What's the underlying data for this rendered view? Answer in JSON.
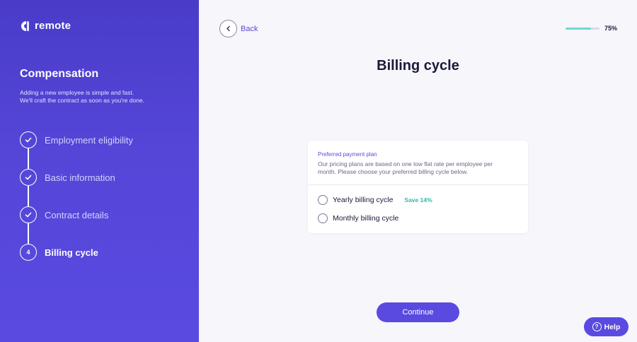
{
  "brand": {
    "name": "remote"
  },
  "sidebar": {
    "title": "Compensation",
    "description_line1": "Adding a new employee is simple and fast.",
    "description_line2": "We'll craft the contract as soon as you're done.",
    "steps": [
      {
        "label": "Employment eligibility",
        "status": "done",
        "icon": "check-icon"
      },
      {
        "label": "Basic information",
        "status": "done",
        "icon": "check-icon"
      },
      {
        "label": "Contract details",
        "status": "done",
        "icon": "check-icon"
      },
      {
        "label": "Billing cycle",
        "status": "active",
        "number": "4"
      }
    ]
  },
  "header": {
    "back_label": "Back",
    "progress_value": 0.75,
    "progress_label": "75%"
  },
  "main": {
    "title": "Billing cycle",
    "card": {
      "subtitle": "Preferred payment plan",
      "description_line1": "Our pricing plans are based on one low flat rate per employee per",
      "description_line2": "month. Please choose your preferred billing cycle below.",
      "options": [
        {
          "label": "Yearly billing cycle",
          "badge": "Save 14%",
          "selected": false
        },
        {
          "label": "Monthly billing cycle",
          "selected": false
        }
      ]
    },
    "continue_label": "Continue"
  },
  "help": {
    "label": "Help",
    "icon_glyph": "?"
  },
  "colors": {
    "accent": "#5a4adf",
    "sidebar": "#4a3cc9",
    "progress": "#6fd9d1",
    "badge": "#2fb8ad"
  }
}
